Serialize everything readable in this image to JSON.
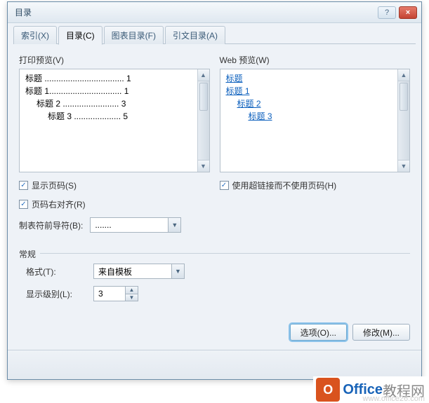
{
  "dialog": {
    "title": "目录",
    "help": "?",
    "close": "×"
  },
  "tabs": [
    {
      "label": "索引(X)",
      "active": false
    },
    {
      "label": "目录(C)",
      "active": true
    },
    {
      "label": "图表目录(F)",
      "active": false
    },
    {
      "label": "引文目录(A)",
      "active": false
    }
  ],
  "printPreview": {
    "label": "打印预览(V)",
    "lines": [
      {
        "text": "标题 .................................. 1",
        "indent": 0
      },
      {
        "text": "标题 1............................... 1",
        "indent": 0
      },
      {
        "text": "标题 2 ........................ 3",
        "indent": 1
      },
      {
        "text": "标题 3 .................... 5",
        "indent": 2
      }
    ]
  },
  "webPreview": {
    "label": "Web 预览(W)",
    "lines": [
      {
        "text": "标题",
        "indent": 0
      },
      {
        "text": "标题 1",
        "indent": 0
      },
      {
        "text": "标题 2",
        "indent": 1
      },
      {
        "text": "标题 3",
        "indent": 2
      }
    ]
  },
  "options": {
    "showPageNumbers": {
      "label": "显示页码(S)",
      "checked": true
    },
    "rightAlign": {
      "label": "页码右对齐(R)",
      "checked": true
    },
    "useHyperlinks": {
      "label": "使用超链接而不使用页码(H)",
      "checked": true
    },
    "tabLeader": {
      "label": "制表符前导符(B):",
      "value": "......."
    }
  },
  "general": {
    "legend": "常规",
    "format": {
      "label": "格式(T):",
      "value": "来自模板"
    },
    "showLevels": {
      "label": "显示级别(L):",
      "value": "3"
    }
  },
  "buttons": {
    "options": "选项(O)...",
    "modify": "修改(M)..."
  },
  "watermark": {
    "badge": "O",
    "text1": "Office",
    "text2": "教程网",
    "url": "www.office26.com"
  }
}
